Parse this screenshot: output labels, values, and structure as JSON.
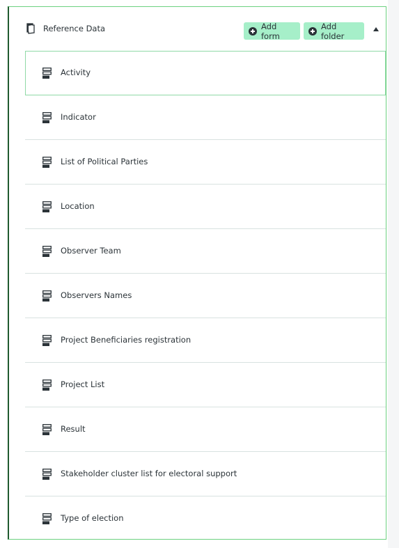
{
  "folder": {
    "title": "Reference Data",
    "icon": "folder-icon",
    "expanded": true,
    "buttons": {
      "add_form": "Add form",
      "add_folder": "Add folder"
    },
    "collapse_icon": "caret-up-icon"
  },
  "forms": [
    {
      "label": "Activity",
      "icon": "form-icon",
      "active": true
    },
    {
      "label": "Indicator",
      "icon": "form-icon"
    },
    {
      "label": "List of Political Parties",
      "icon": "form-icon"
    },
    {
      "label": "Location",
      "icon": "form-icon"
    },
    {
      "label": "Observer Team",
      "icon": "form-icon"
    },
    {
      "label": "Observers Names",
      "icon": "form-icon"
    },
    {
      "label": "Project Beneficiaries registration",
      "icon": "form-icon"
    },
    {
      "label": "Project List",
      "icon": "form-icon"
    },
    {
      "label": "Result",
      "icon": "form-icon"
    },
    {
      "label": "Stakeholder cluster list for electoral support",
      "icon": "form-icon"
    },
    {
      "label": "Type of election",
      "icon": "form-icon"
    }
  ],
  "colors": {
    "accent_border": "#6cd17f",
    "button_bg": "#a6efc9",
    "text": "#2b3338"
  }
}
